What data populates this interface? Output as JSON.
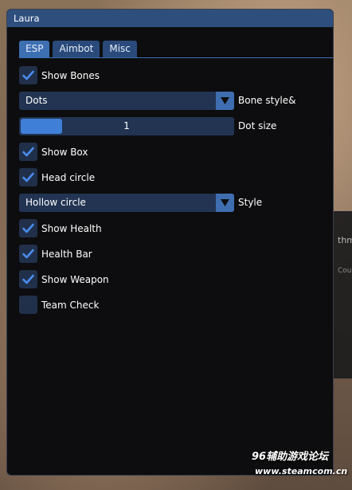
{
  "window": {
    "title": "Laura"
  },
  "tabs": [
    {
      "label": "ESP",
      "active": true
    },
    {
      "label": "Aimbot",
      "active": false
    },
    {
      "label": "Misc",
      "active": false
    }
  ],
  "controls": {
    "show_bones": {
      "label": "Show Bones",
      "checked": true
    },
    "bone_style": {
      "value": "Dots",
      "label": "Bone style&"
    },
    "dot_size": {
      "value": "1",
      "label": "Dot size",
      "level": 0.19
    },
    "show_box": {
      "label": "Show Box",
      "checked": true
    },
    "head_circle": {
      "label": "Head circle",
      "checked": true
    },
    "head_style": {
      "value": "Hollow circle",
      "label": "Style"
    },
    "show_health": {
      "label": "Show Health",
      "checked": true
    },
    "health_bar": {
      "label": "Health Bar",
      "checked": true
    },
    "show_weapon": {
      "label": "Show Weapon",
      "checked": true
    },
    "team_check": {
      "label": "Team Check",
      "checked": false
    }
  },
  "background": {
    "text_1": "thm",
    "text_2": "Coun"
  },
  "watermark": {
    "line_1": "96辅助游戏论坛",
    "line_2": "www.steamcom.cn"
  },
  "colors": {
    "accent": "#3d6fb3",
    "check": "#4a8cf0",
    "frame_bg": "#223452",
    "window_bg": "#0d0d0f"
  }
}
